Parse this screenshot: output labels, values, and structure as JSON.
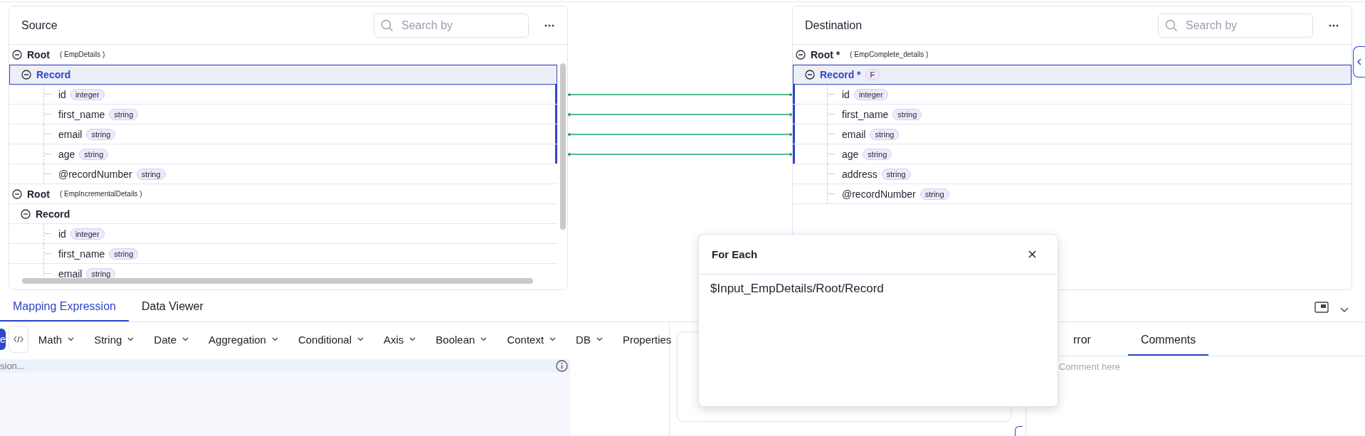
{
  "source": {
    "title": "Source",
    "search": {
      "placeholder": "Search by"
    },
    "tree": [
      {
        "label": "Root",
        "schema": "( EmpDetails )",
        "expanded": true,
        "selected": false,
        "children": [
          {
            "label": "Record",
            "expanded": true,
            "selected": true,
            "children": [
              {
                "label": "id",
                "type": "integer",
                "mapped": true,
                "selected": false
              },
              {
                "label": "first_name",
                "type": "string",
                "mapped": true,
                "selected": false
              },
              {
                "label": "email",
                "type": "string",
                "mapped": true,
                "selected": false
              },
              {
                "label": "age",
                "type": "string",
                "mapped": true,
                "selected": false
              },
              {
                "label": "@recordNumber",
                "type": "string",
                "mapped": false,
                "selected": false
              }
            ]
          }
        ]
      },
      {
        "label": "Root",
        "schema": "( EmpIncrementalDetails )",
        "expanded": true,
        "selected": false,
        "children": [
          {
            "label": "Record",
            "expanded": true,
            "selected": false,
            "children": [
              {
                "label": "id",
                "type": "integer",
                "mapped": false,
                "selected": false
              },
              {
                "label": "first_name",
                "type": "string",
                "mapped": false,
                "selected": false
              },
              {
                "label": "email",
                "type": "string",
                "mapped": false,
                "selected": false
              }
            ]
          }
        ]
      }
    ]
  },
  "destination": {
    "title": "Destination",
    "search": {
      "placeholder": "Search by"
    },
    "tree": [
      {
        "label": "Root *",
        "schema": "( EmpComplete_details )",
        "expanded": true,
        "selected": false,
        "children": [
          {
            "label": "Record *",
            "badge": "F",
            "expanded": true,
            "selected": true,
            "children": [
              {
                "label": "id",
                "type": "integer",
                "mapped": true,
                "selected": false
              },
              {
                "label": "first_name",
                "type": "string",
                "mapped": true,
                "selected": false
              },
              {
                "label": "email",
                "type": "string",
                "mapped": true,
                "selected": false
              },
              {
                "label": "age",
                "type": "string",
                "mapped": true,
                "selected": false
              },
              {
                "label": "address",
                "type": "string",
                "mapped": false,
                "selected": false
              },
              {
                "label": "@recordNumber",
                "type": "string",
                "mapped": false,
                "selected": false
              }
            ]
          }
        ]
      }
    ]
  },
  "bottom_tabs": [
    {
      "label": "Mapping Expression",
      "selected": true
    },
    {
      "label": "Data Viewer",
      "selected": false
    }
  ],
  "toolbar": {
    "primary_button": "e",
    "menus": [
      {
        "label": "Math",
        "dropdown": true
      },
      {
        "label": "String",
        "dropdown": true
      },
      {
        "label": "Date",
        "dropdown": true
      },
      {
        "label": "Aggregation",
        "dropdown": true
      },
      {
        "label": "Conditional",
        "dropdown": true
      },
      {
        "label": "Axis",
        "dropdown": true
      },
      {
        "label": "Boolean",
        "dropdown": true
      },
      {
        "label": "Context",
        "dropdown": true
      },
      {
        "label": "DB",
        "dropdown": true
      },
      {
        "label": "Properties",
        "dropdown": false
      }
    ]
  },
  "expression": {
    "placeholder": "sion..."
  },
  "right_tabs": [
    {
      "label": "rror",
      "selected": false
    },
    {
      "label": "Comments",
      "selected": true
    }
  ],
  "comment": {
    "placeholder": "Comment here"
  },
  "popup": {
    "title": "For Each",
    "value": "$Input_EmpDetails/Root/Record"
  }
}
